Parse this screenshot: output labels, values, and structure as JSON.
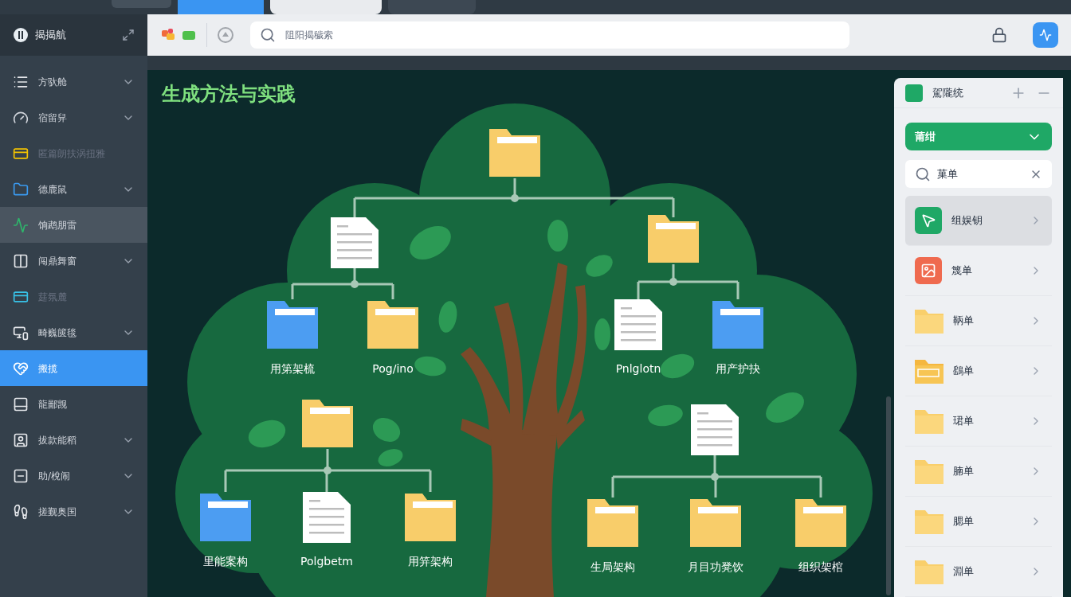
{
  "app": {
    "title": "揭揭航"
  },
  "toolbar": {
    "search": {
      "placeholder": "阻阳揭穢索"
    }
  },
  "sidebar": {
    "items": [
      {
        "label": "方驮舱",
        "expandable": true,
        "disabled": false,
        "selected": false,
        "hover": false
      },
      {
        "label": "宿留舁",
        "expandable": true,
        "disabled": false,
        "selected": false,
        "hover": false
      },
      {
        "label": "匿篇朗扶涡扭雅",
        "expandable": false,
        "disabled": true,
        "selected": false,
        "hover": false
      },
      {
        "label": "德鹿鼠",
        "expandable": true,
        "disabled": false,
        "selected": false,
        "hover": false
      },
      {
        "label": "饷鹉朋雷",
        "expandable": false,
        "disabled": false,
        "selected": false,
        "hover": true
      },
      {
        "label": "闯鼎舞窗",
        "expandable": true,
        "disabled": false,
        "selected": false,
        "hover": false
      },
      {
        "label": "莛氛麓",
        "expandable": false,
        "disabled": true,
        "selected": false,
        "hover": false
      },
      {
        "label": "畸巍篋毯",
        "expandable": true,
        "disabled": false,
        "selected": false,
        "hover": false
      },
      {
        "label": "搬揽",
        "expandable": false,
        "disabled": false,
        "selected": true,
        "hover": false
      },
      {
        "label": "龍鄙觊",
        "expandable": false,
        "disabled": false,
        "selected": false,
        "hover": false
      },
      {
        "label": "拔款能稻",
        "expandable": true,
        "disabled": false,
        "selected": false,
        "hover": false
      },
      {
        "label": "助/梲闹",
        "expandable": true,
        "disabled": false,
        "selected": false,
        "hover": false
      },
      {
        "label": "搓觐奥国",
        "expandable": true,
        "disabled": false,
        "selected": false,
        "hover": false
      }
    ]
  },
  "canvas": {
    "title": "生成方法与实践",
    "trees": [
      {
        "kind": "folder",
        "color": "#f8cd6a",
        "children": [
          {
            "kind": "document",
            "children": [
              {
                "kind": "folder",
                "color": "#4c9df2",
                "label": "用第架梳"
              },
              {
                "kind": "folder",
                "color": "#f8cd6a",
                "label": "Pog/ino"
              }
            ]
          },
          {
            "kind": "folder",
            "color": "#f8cd6a",
            "children": [
              {
                "kind": "document",
                "label": "Pnlglotn"
              },
              {
                "kind": "folder",
                "color": "#4c9df2",
                "label": "用产护抉"
              }
            ]
          }
        ]
      },
      {
        "kind": "folder",
        "color": "#f8cd6a",
        "children": [
          {
            "kind": "folder",
            "color": "#4c9df2",
            "label": "里能案构"
          },
          {
            "kind": "document",
            "label": "Polgbetm"
          },
          {
            "kind": "folder",
            "color": "#f8cd6a",
            "label": "用笄架构"
          }
        ]
      },
      {
        "kind": "document",
        "children": [
          {
            "kind": "folder",
            "color": "#f8cd6a",
            "label": "生局架构"
          },
          {
            "kind": "folder",
            "color": "#f8cd6a",
            "label": "月目功凳饮"
          },
          {
            "kind": "folder",
            "color": "#f8cd6a",
            "label": "组织架棺"
          }
        ]
      }
    ]
  },
  "panel": {
    "title": "駕隴统",
    "dropdown": {
      "value": "莆绀"
    },
    "search": {
      "value": "菓单"
    },
    "items": [
      {
        "label": "组娱钥",
        "kind": "green-app",
        "selected": true
      },
      {
        "label": "篾单",
        "kind": "red-app",
        "selected": false
      },
      {
        "label": "鞆单",
        "kind": "folder",
        "selected": false
      },
      {
        "label": "鷂单",
        "kind": "folder-alt",
        "selected": false
      },
      {
        "label": "珺单",
        "kind": "folder",
        "selected": false
      },
      {
        "label": "腩单",
        "kind": "folder",
        "selected": false
      },
      {
        "label": "腮单",
        "kind": "folder",
        "selected": false
      },
      {
        "label": "淵单",
        "kind": "folder",
        "selected": false
      }
    ]
  }
}
